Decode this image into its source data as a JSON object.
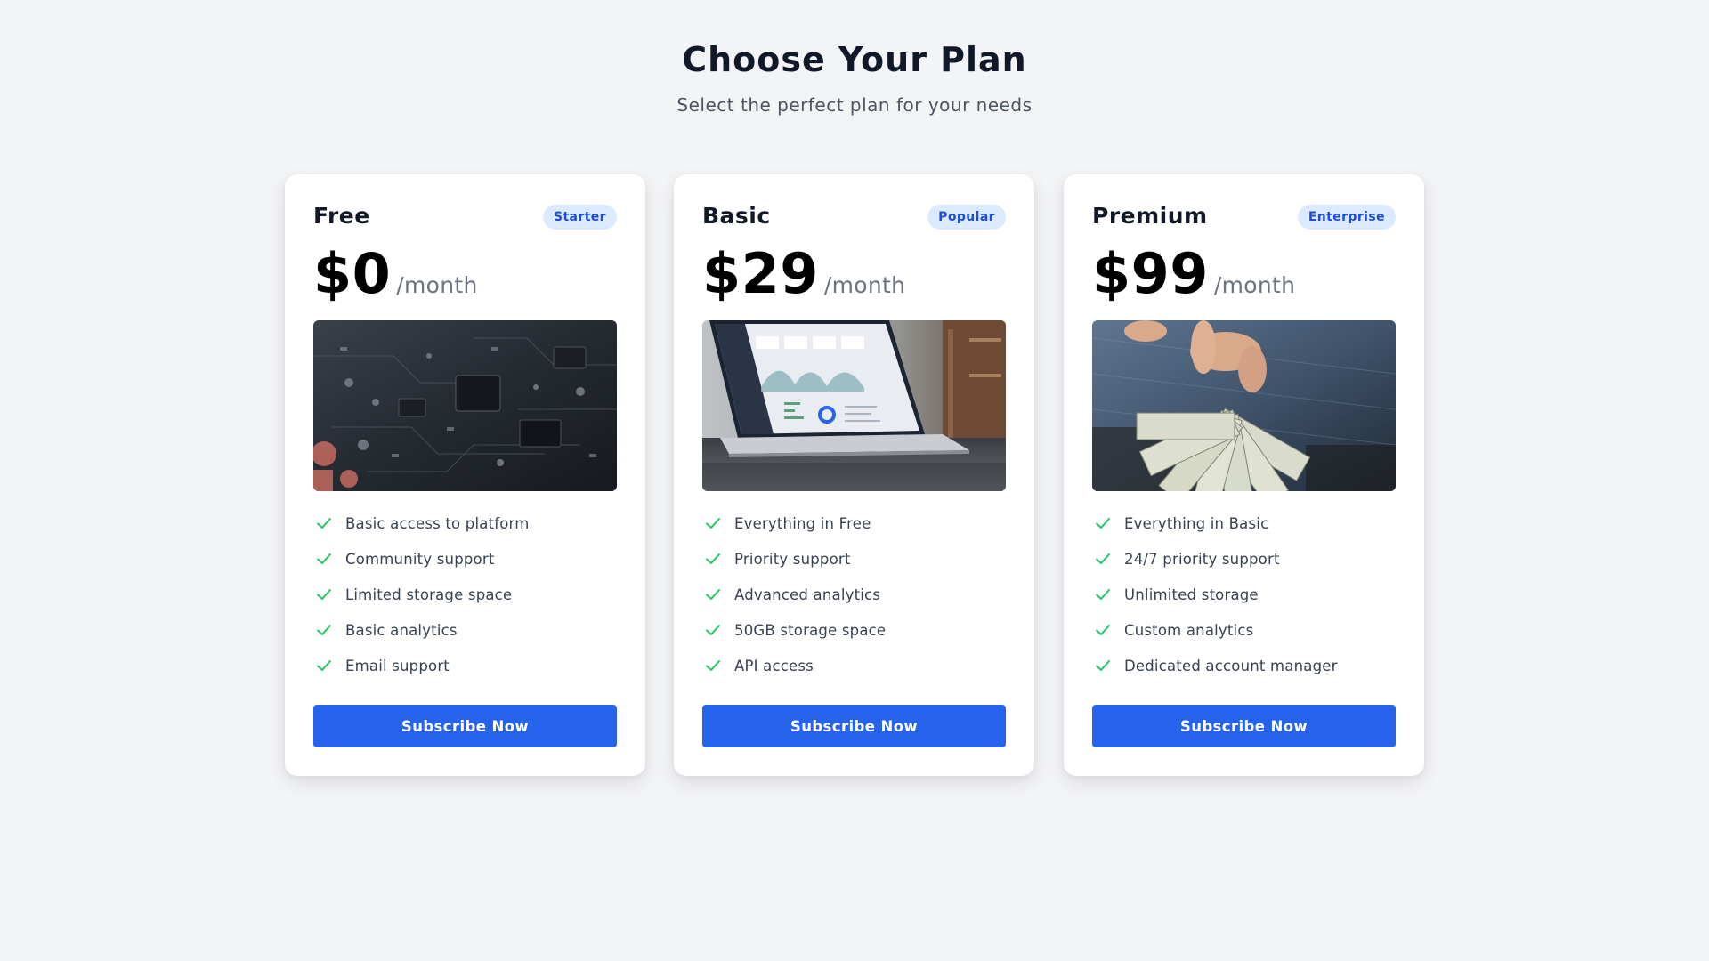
{
  "header": {
    "title": "Choose Your Plan",
    "subtitle": "Select the perfect plan for your needs"
  },
  "colors": {
    "background": "#f3f4f6",
    "card": "#ffffff",
    "accent": "#2563eb",
    "badge_bg": "#dbeafe",
    "badge_text": "#1d4ed8",
    "check": "#22c55e"
  },
  "plans": [
    {
      "name": "Free",
      "badge": "Starter",
      "price": "$0",
      "period": "/month",
      "image": "circuit-board-photo",
      "features": [
        "Basic access to platform",
        "Community support",
        "Limited storage space",
        "Basic analytics",
        "Email support"
      ],
      "cta": "Subscribe Now"
    },
    {
      "name": "Basic",
      "badge": "Popular",
      "price": "$29",
      "period": "/month",
      "image": "laptop-dashboard-photo",
      "features": [
        "Everything in Free",
        "Priority support",
        "Advanced analytics",
        "50GB storage space",
        "API access"
      ],
      "cta": "Subscribe Now"
    },
    {
      "name": "Premium",
      "badge": "Enterprise",
      "price": "$99",
      "period": "/month",
      "image": "cash-in-hands-photo",
      "features": [
        "Everything in Basic",
        "24/7 priority support",
        "Unlimited storage",
        "Custom analytics",
        "Dedicated account manager"
      ],
      "cta": "Subscribe Now"
    }
  ],
  "icons": {
    "feature_check": "check-icon"
  }
}
